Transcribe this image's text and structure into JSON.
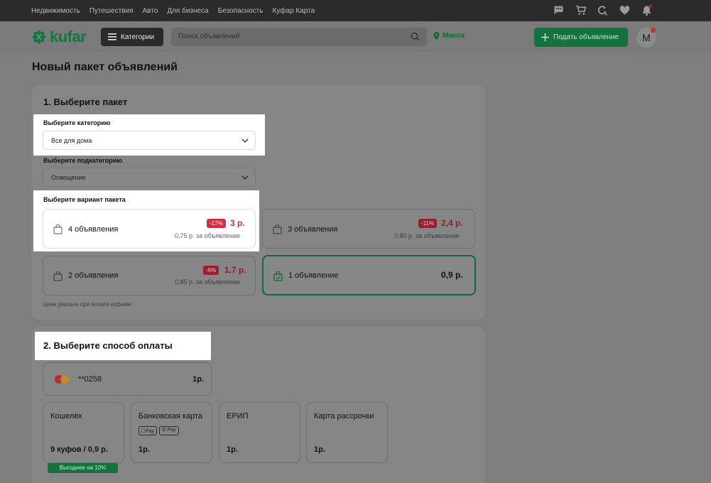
{
  "topnav": {
    "links": [
      "Недвижимость",
      "Путешествия",
      "Авто",
      "Для бизнеса",
      "Безопасность",
      "Куфар Карта"
    ],
    "icons": [
      "chat-icon",
      "cart-icon",
      "refresh-search-icon",
      "heart-icon",
      "bell-icon"
    ]
  },
  "header": {
    "logo_text": "kufar",
    "categories_label": "Категории",
    "search_placeholder": "Поиск объявлений",
    "city": "Минск",
    "post_ad_label": "Подать объявление",
    "avatar_letter": "М",
    "brand_color": "#0f7a3d"
  },
  "page": {
    "title": "Новый пакет объявлений"
  },
  "step1": {
    "title": "1. Выберите пакет",
    "category_label": "Выберите категорию",
    "category_value": "Все для дома",
    "subcategory_label": "Выберите подкатегорию",
    "subcategory_value": "Освещение",
    "variant_label": "Выберите вариант пакета",
    "packages": [
      {
        "name": "4 объявления",
        "discount": "-17%",
        "price": "3 р.",
        "per": "0,75 р. за объявление"
      },
      {
        "name": "3 объявления",
        "discount": "-11%",
        "price": "2,4 р.",
        "per": "0,80 р. за объявление"
      },
      {
        "name": "2 объявления",
        "discount": "-6%",
        "price": "1,7 р.",
        "per": "0,85 р. за объявление"
      },
      {
        "name": "1 объявление",
        "price": "0,9 р.",
        "selected": true
      }
    ],
    "note": "Цена указана при оплате куфами"
  },
  "step2": {
    "title": "2. Выберите способ оплаты",
    "saved_card": {
      "mask": "**0258",
      "amount": "1р."
    },
    "methods": [
      {
        "title": "Кошелёк",
        "amount": "9 куфов / 0,9 р.",
        "badge": "Выгоднее на 10%"
      },
      {
        "title": "Банковская карта",
        "amount": "1р.",
        "tags": [
          "Pay",
          "G Pay"
        ]
      },
      {
        "title": "ЕРИП",
        "amount": "1р."
      },
      {
        "title": "Карта рассрочки",
        "amount": "1р."
      }
    ]
  }
}
